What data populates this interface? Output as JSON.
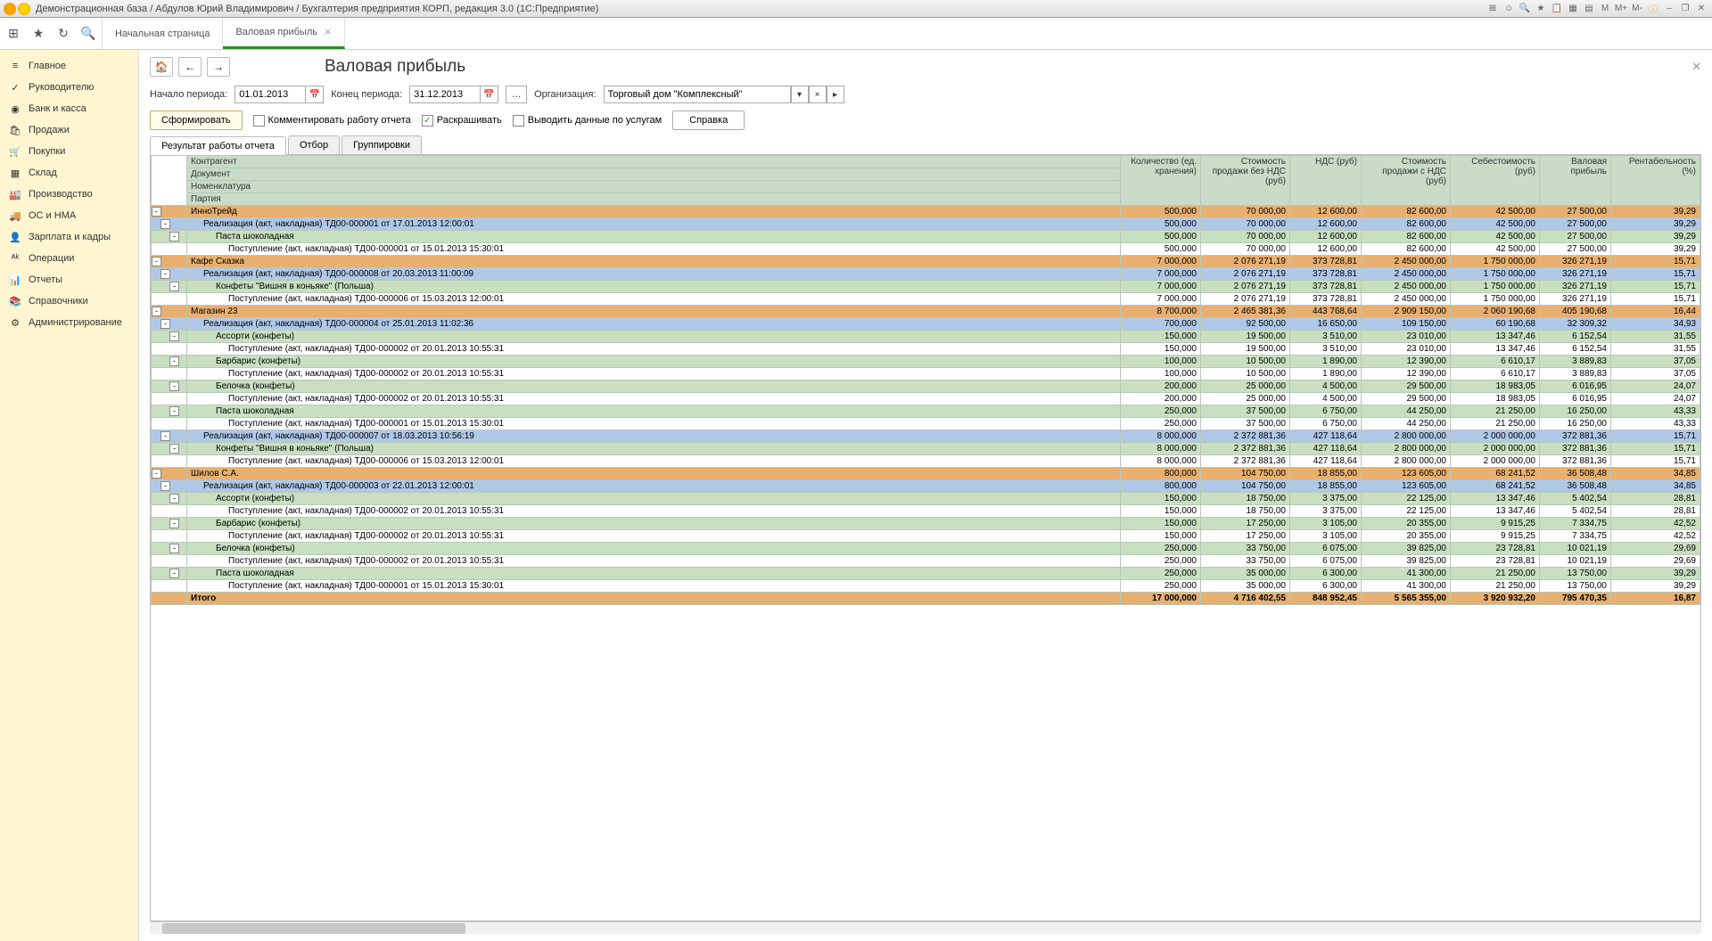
{
  "titlebar": {
    "title": "Демонстрационная база / Абдулов Юрий Владимирович / Бухгалтерия предприятия КОРП, редакция 3.0  (1С:Предприятие)"
  },
  "tabs": [
    {
      "label": "Начальная страница"
    },
    {
      "label": "Валовая прибыль"
    }
  ],
  "sidebar": [
    {
      "icon": "≡",
      "label": "Главное"
    },
    {
      "icon": "✓",
      "label": "Руководителю"
    },
    {
      "icon": "◉",
      "label": "Банк и касса"
    },
    {
      "icon": "🛍",
      "label": "Продажи"
    },
    {
      "icon": "🛒",
      "label": "Покупки"
    },
    {
      "icon": "▦",
      "label": "Склад"
    },
    {
      "icon": "🏭",
      "label": "Производство"
    },
    {
      "icon": "🚚",
      "label": "ОС и НМА"
    },
    {
      "icon": "👤",
      "label": "Зарплата и кадры"
    },
    {
      "icon": "ᴬᵏ",
      "label": "Операции"
    },
    {
      "icon": "📊",
      "label": "Отчеты"
    },
    {
      "icon": "📚",
      "label": "Справочники"
    },
    {
      "icon": "⚙",
      "label": "Администрирование"
    }
  ],
  "page": {
    "title": "Валовая прибыль",
    "start_label": "Начало периода:",
    "start_date": "01.01.2013",
    "end_label": "Конец периода:",
    "end_date": "31.12.2013",
    "org_label": "Организация:",
    "org_value": "Торговый дом \"Комплексный\"",
    "form_btn": "Сформировать",
    "comment_chk": "Комментировать работу отчета",
    "color_chk": "Раскрашивать",
    "services_chk": "Выводить данные по услугам",
    "help_btn": "Справка",
    "subtabs": [
      "Результат работы отчета",
      "Отбор",
      "Группировки"
    ]
  },
  "headers": {
    "group": [
      "Контрагент",
      "Документ",
      "Номенклатура",
      "Партия"
    ],
    "cols": [
      "Количество (ед. хранения)",
      "Стоимость продажи без НДС (руб)",
      "НДС (руб)",
      "Стоимость продажи с НДС (руб)",
      "Себестоимость (руб)",
      "Валовая прибыль",
      "Рентабельность (%)"
    ]
  },
  "rows": [
    {
      "lvl": "orange",
      "indent": 0,
      "tree": "-",
      "label": "ИнноТрейд",
      "v": [
        "500,000",
        "70 000,00",
        "12 600,00",
        "82 600,00",
        "42 500,00",
        "27 500,00",
        "39,29"
      ]
    },
    {
      "lvl": "blue",
      "indent": 1,
      "tree": "-",
      "label": "Реализация (акт, накладная) ТД00-000001 от 17.01.2013 12:00:01",
      "v": [
        "500,000",
        "70 000,00",
        "12 600,00",
        "82 600,00",
        "42 500,00",
        "27 500,00",
        "39,29"
      ]
    },
    {
      "lvl": "green",
      "indent": 2,
      "tree": "-",
      "label": "Паста шоколадная",
      "v": [
        "500,000",
        "70 000,00",
        "12 600,00",
        "82 600,00",
        "42 500,00",
        "27 500,00",
        "39,29"
      ]
    },
    {
      "lvl": "white",
      "indent": 3,
      "tree": "",
      "label": "Поступление (акт, накладная) ТД00-000001 от 15.01.2013 15:30:01",
      "v": [
        "500,000",
        "70 000,00",
        "12 600,00",
        "82 600,00",
        "42 500,00",
        "27 500,00",
        "39,29"
      ]
    },
    {
      "lvl": "orange",
      "indent": 0,
      "tree": "-",
      "label": "Кафе Сказка",
      "v": [
        "7 000,000",
        "2 076 271,19",
        "373 728,81",
        "2 450 000,00",
        "1 750 000,00",
        "326 271,19",
        "15,71"
      ]
    },
    {
      "lvl": "blue",
      "indent": 1,
      "tree": "-",
      "label": "Реализация (акт, накладная) ТД00-000008 от 20.03.2013 11:00:09",
      "v": [
        "7 000,000",
        "2 076 271,19",
        "373 728,81",
        "2 450 000,00",
        "1 750 000,00",
        "326 271,19",
        "15,71"
      ]
    },
    {
      "lvl": "green",
      "indent": 2,
      "tree": "-",
      "label": "Конфеты \"Вишня в коньяке\"  (Польша)",
      "v": [
        "7 000,000",
        "2 076 271,19",
        "373 728,81",
        "2 450 000,00",
        "1 750 000,00",
        "326 271,19",
        "15,71"
      ]
    },
    {
      "lvl": "white",
      "indent": 3,
      "tree": "",
      "label": "Поступление (акт, накладная) ТД00-000006 от 15.03.2013 12:00:01",
      "v": [
        "7 000,000",
        "2 076 271,19",
        "373 728,81",
        "2 450 000,00",
        "1 750 000,00",
        "326 271,19",
        "15,71"
      ]
    },
    {
      "lvl": "orange",
      "indent": 0,
      "tree": "-",
      "label": "Магазин 23",
      "v": [
        "8 700,000",
        "2 465 381,36",
        "443 768,64",
        "2 909 150,00",
        "2 060 190,68",
        "405 190,68",
        "16,44"
      ]
    },
    {
      "lvl": "blue",
      "indent": 1,
      "tree": "-",
      "label": "Реализация (акт, накладная) ТД00-000004 от 25.01.2013 11:02:36",
      "v": [
        "700,000",
        "92 500,00",
        "16 650,00",
        "109 150,00",
        "60 190,68",
        "32 309,32",
        "34,93"
      ]
    },
    {
      "lvl": "green",
      "indent": 2,
      "tree": "-",
      "label": "Ассорти (конфеты)",
      "v": [
        "150,000",
        "19 500,00",
        "3 510,00",
        "23 010,00",
        "13 347,46",
        "6 152,54",
        "31,55"
      ]
    },
    {
      "lvl": "white",
      "indent": 3,
      "tree": "",
      "label": "Поступление (акт, накладная) ТД00-000002 от 20.01.2013 10:55:31",
      "v": [
        "150,000",
        "19 500,00",
        "3 510,00",
        "23 010,00",
        "13 347,46",
        "6 152,54",
        "31,55"
      ]
    },
    {
      "lvl": "green",
      "indent": 2,
      "tree": "-",
      "label": "Барбарис (конфеты)",
      "v": [
        "100,000",
        "10 500,00",
        "1 890,00",
        "12 390,00",
        "6 610,17",
        "3 889,83",
        "37,05"
      ]
    },
    {
      "lvl": "white",
      "indent": 3,
      "tree": "",
      "label": "Поступление (акт, накладная) ТД00-000002 от 20.01.2013 10:55:31",
      "v": [
        "100,000",
        "10 500,00",
        "1 890,00",
        "12 390,00",
        "6 610,17",
        "3 889,83",
        "37,05"
      ]
    },
    {
      "lvl": "green",
      "indent": 2,
      "tree": "-",
      "label": "Белочка (конфеты)",
      "v": [
        "200,000",
        "25 000,00",
        "4 500,00",
        "29 500,00",
        "18 983,05",
        "6 016,95",
        "24,07"
      ]
    },
    {
      "lvl": "white",
      "indent": 3,
      "tree": "",
      "label": "Поступление (акт, накладная) ТД00-000002 от 20.01.2013 10:55:31",
      "v": [
        "200,000",
        "25 000,00",
        "4 500,00",
        "29 500,00",
        "18 983,05",
        "6 016,95",
        "24,07"
      ]
    },
    {
      "lvl": "green",
      "indent": 2,
      "tree": "-",
      "label": "Паста шоколадная",
      "v": [
        "250,000",
        "37 500,00",
        "6 750,00",
        "44 250,00",
        "21 250,00",
        "16 250,00",
        "43,33"
      ]
    },
    {
      "lvl": "white",
      "indent": 3,
      "tree": "",
      "label": "Поступление (акт, накладная) ТД00-000001 от 15.01.2013 15:30:01",
      "v": [
        "250,000",
        "37 500,00",
        "6 750,00",
        "44 250,00",
        "21 250,00",
        "16 250,00",
        "43,33"
      ]
    },
    {
      "lvl": "blue",
      "indent": 1,
      "tree": "-",
      "label": "Реализация (акт, накладная) ТД00-000007 от 18.03.2013 10:56:19",
      "v": [
        "8 000,000",
        "2 372 881,36",
        "427 118,64",
        "2 800 000,00",
        "2 000 000,00",
        "372 881,36",
        "15,71"
      ]
    },
    {
      "lvl": "green",
      "indent": 2,
      "tree": "-",
      "label": "Конфеты \"Вишня в коньяке\"  (Польша)",
      "v": [
        "8 000,000",
        "2 372 881,36",
        "427 118,64",
        "2 800 000,00",
        "2 000 000,00",
        "372 881,36",
        "15,71"
      ]
    },
    {
      "lvl": "white",
      "indent": 3,
      "tree": "",
      "label": "Поступление (акт, накладная) ТД00-000006 от 15.03.2013 12:00:01",
      "v": [
        "8 000,000",
        "2 372 881,36",
        "427 118,64",
        "2 800 000,00",
        "2 000 000,00",
        "372 881,36",
        "15,71"
      ]
    },
    {
      "lvl": "orange",
      "indent": 0,
      "tree": "-",
      "label": "Шилов С.А.",
      "v": [
        "800,000",
        "104 750,00",
        "18 855,00",
        "123 605,00",
        "68 241,52",
        "36 508,48",
        "34,85"
      ]
    },
    {
      "lvl": "blue",
      "indent": 1,
      "tree": "-",
      "label": "Реализация (акт, накладная) ТД00-000003 от 22.01.2013 12:00:01",
      "v": [
        "800,000",
        "104 750,00",
        "18 855,00",
        "123 605,00",
        "68 241,52",
        "36 508,48",
        "34,85"
      ]
    },
    {
      "lvl": "green",
      "indent": 2,
      "tree": "-",
      "label": "Ассорти (конфеты)",
      "v": [
        "150,000",
        "18 750,00",
        "3 375,00",
        "22 125,00",
        "13 347,46",
        "5 402,54",
        "28,81"
      ]
    },
    {
      "lvl": "white",
      "indent": 3,
      "tree": "",
      "label": "Поступление (акт, накладная) ТД00-000002 от 20.01.2013 10:55:31",
      "v": [
        "150,000",
        "18 750,00",
        "3 375,00",
        "22 125,00",
        "13 347,46",
        "5 402,54",
        "28,81"
      ]
    },
    {
      "lvl": "green",
      "indent": 2,
      "tree": "-",
      "label": "Барбарис (конфеты)",
      "v": [
        "150,000",
        "17 250,00",
        "3 105,00",
        "20 355,00",
        "9 915,25",
        "7 334,75",
        "42,52"
      ]
    },
    {
      "lvl": "white",
      "indent": 3,
      "tree": "",
      "label": "Поступление (акт, накладная) ТД00-000002 от 20.01.2013 10:55:31",
      "v": [
        "150,000",
        "17 250,00",
        "3 105,00",
        "20 355,00",
        "9 915,25",
        "7 334,75",
        "42,52"
      ]
    },
    {
      "lvl": "green",
      "indent": 2,
      "tree": "-",
      "label": "Белочка (конфеты)",
      "v": [
        "250,000",
        "33 750,00",
        "6 075,00",
        "39 825,00",
        "23 728,81",
        "10 021,19",
        "29,69"
      ]
    },
    {
      "lvl": "white",
      "indent": 3,
      "tree": "",
      "label": "Поступление (акт, накладная) ТД00-000002 от 20.01.2013 10:55:31",
      "v": [
        "250,000",
        "33 750,00",
        "6 075,00",
        "39 825,00",
        "23 728,81",
        "10 021,19",
        "29,69"
      ]
    },
    {
      "lvl": "green",
      "indent": 2,
      "tree": "-",
      "label": "Паста шоколадная",
      "v": [
        "250,000",
        "35 000,00",
        "6 300,00",
        "41 300,00",
        "21 250,00",
        "13 750,00",
        "39,29"
      ]
    },
    {
      "lvl": "white",
      "indent": 3,
      "tree": "",
      "label": "Поступление (акт, накладная) ТД00-000001 от 15.01.2013 15:30:01",
      "v": [
        "250,000",
        "35 000,00",
        "6 300,00",
        "41 300,00",
        "21 250,00",
        "13 750,00",
        "39,29"
      ]
    }
  ],
  "total": {
    "label": "Итого",
    "v": [
      "17 000,000",
      "4 716 402,55",
      "848 952,45",
      "5 565 355,00",
      "3 920 932,20",
      "795 470,35",
      "16,87"
    ]
  }
}
